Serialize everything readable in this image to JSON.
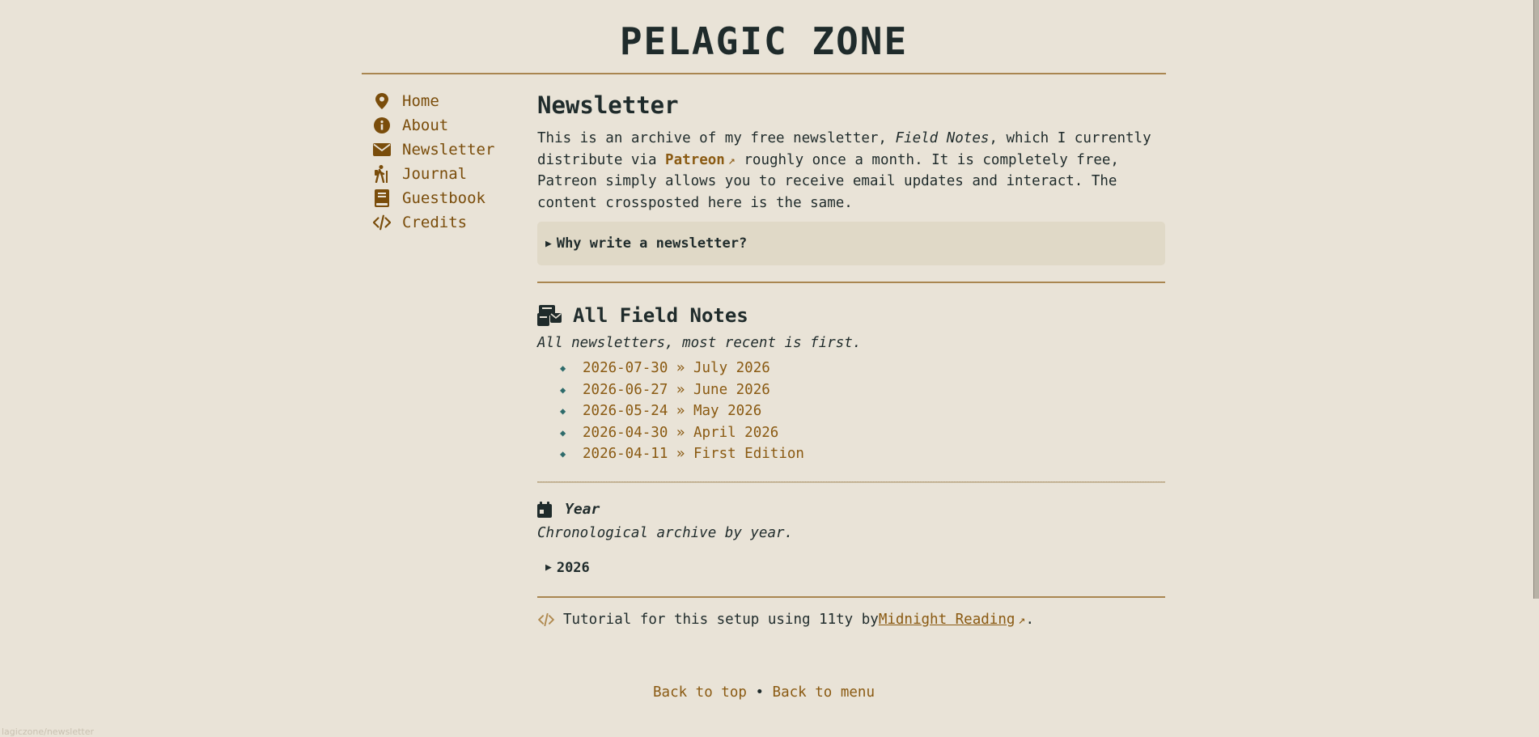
{
  "site": {
    "title": "PELAGIC ZONE"
  },
  "nav": [
    {
      "label": "Home",
      "icon": "map-pin-icon"
    },
    {
      "label": "About",
      "icon": "info-circle-icon"
    },
    {
      "label": "Newsletter",
      "icon": "envelope-icon"
    },
    {
      "label": "Journal",
      "icon": "hiker-icon"
    },
    {
      "label": "Guestbook",
      "icon": "book-icon"
    },
    {
      "label": "Credits",
      "icon": "code-icon"
    }
  ],
  "main": {
    "title": "Newsletter",
    "intro": {
      "part1": "This is an archive of my free newsletter, ",
      "em": "Field Notes",
      "part2": ", which I currently distribute via ",
      "link": "Patreon",
      "ext_glyph": "↗",
      "part3": " roughly once a month. It is completely free, Patreon simply allows you to receive email updates and interact. The content crossposted here is the same."
    },
    "details_summary": "Why write a newsletter?",
    "all_notes": {
      "title": "All Field Notes",
      "subtitle": "All newsletters, most recent is first.",
      "items": [
        "2026-07-30 » July 2026",
        "2026-06-27 » June 2026",
        "2026-05-24 » May 2026",
        "2026-04-30 » April 2026",
        "2026-04-11 » First Edition"
      ]
    },
    "year": {
      "title": "Year",
      "subtitle": "Chronological archive by year.",
      "toggle": "2026"
    },
    "tutorial": {
      "text": "Tutorial for this setup using 11ty by ",
      "link": "Midnight Reading",
      "ext_glyph": "↗",
      "end": "."
    },
    "footer": {
      "back_top": "Back to top",
      "sep": "•",
      "back_menu": "Back to menu"
    }
  },
  "status_url": "lagiczone/newsletter",
  "colors": {
    "background": "#e9e3d7",
    "link": "#8a5a12",
    "rule": "#a98650",
    "diamond": "#2e6b6b"
  }
}
